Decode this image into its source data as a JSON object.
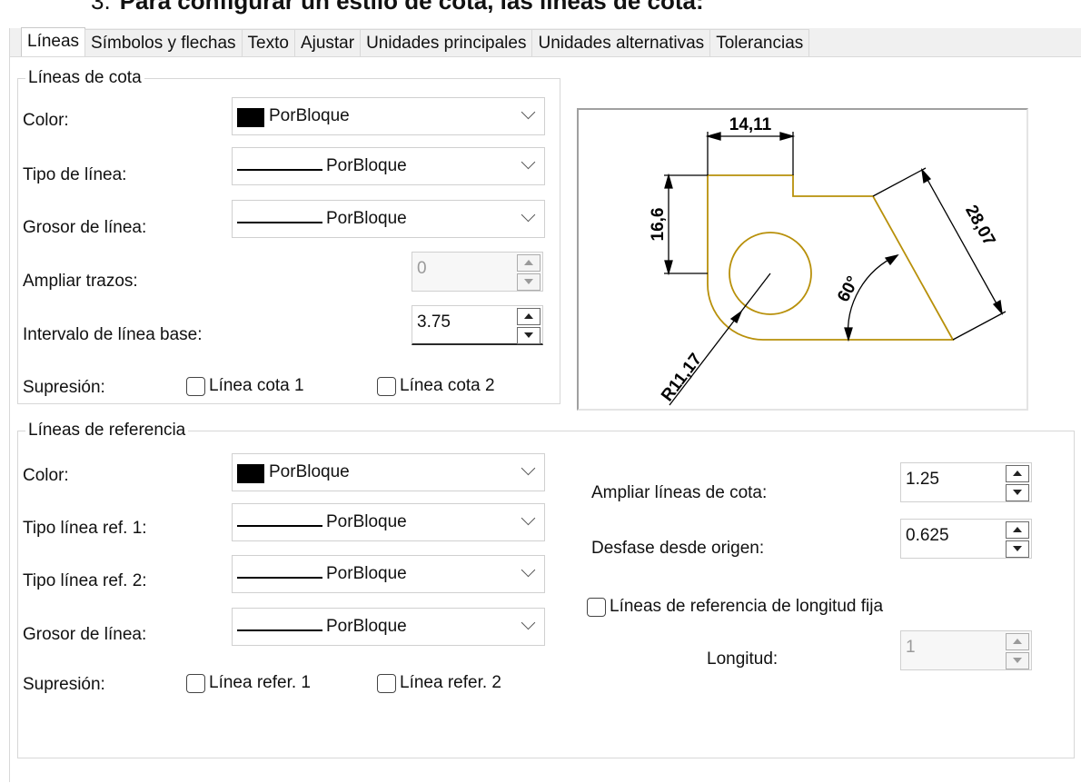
{
  "heading": {
    "number": "3.",
    "text": "Para configurar un estilo de cota, las líneas de cota:"
  },
  "tabs": [
    {
      "label": "Líneas",
      "active": true
    },
    {
      "label": "Símbolos y flechas",
      "active": false
    },
    {
      "label": "Texto",
      "active": false
    },
    {
      "label": "Ajustar",
      "active": false
    },
    {
      "label": "Unidades principales",
      "active": false
    },
    {
      "label": "Unidades alternativas",
      "active": false
    },
    {
      "label": "Tolerancias",
      "active": false
    }
  ],
  "dim_lines": {
    "legend": "Líneas de cota",
    "color_label": "Color:",
    "color_value": "PorBloque",
    "linetype_label": "Tipo de línea:",
    "linetype_value": "PorBloque",
    "lineweight_label": "Grosor de línea:",
    "lineweight_value": "PorBloque",
    "extend_ticks_label": "Ampliar trazos:",
    "extend_ticks_value": "0",
    "baseline_spacing_label": "Intervalo de línea base:",
    "baseline_spacing_value": "3.75",
    "suppress_label": "Supresión:",
    "suppress_1": "Línea cota 1",
    "suppress_2": "Línea cota 2"
  },
  "preview": {
    "dim_top": "14,11",
    "dim_left": "16,6",
    "dim_slant": "28,07",
    "dim_angle": "60°",
    "dim_radius": "R11,17",
    "geometry_color": "#b8900a"
  },
  "ext_lines": {
    "legend": "Líneas de referencia",
    "color_label": "Color:",
    "color_value": "PorBloque",
    "linetype1_label": "Tipo línea ref. 1:",
    "linetype1_value": "PorBloque",
    "linetype2_label": "Tipo línea ref. 2:",
    "linetype2_value": "PorBloque",
    "lineweight_label": "Grosor de línea:",
    "lineweight_value": "PorBloque",
    "suppress_label": "Supresión:",
    "suppress_1": "Línea refer. 1",
    "suppress_2": "Línea refer. 2",
    "extend_label": "Ampliar líneas de cota:",
    "extend_value": "1.25",
    "offset_label": "Desfase desde origen:",
    "offset_value": "0.625",
    "fixed_length_label": "Líneas de referencia de longitud fija",
    "length_label": "Longitud:",
    "length_value": "1"
  }
}
